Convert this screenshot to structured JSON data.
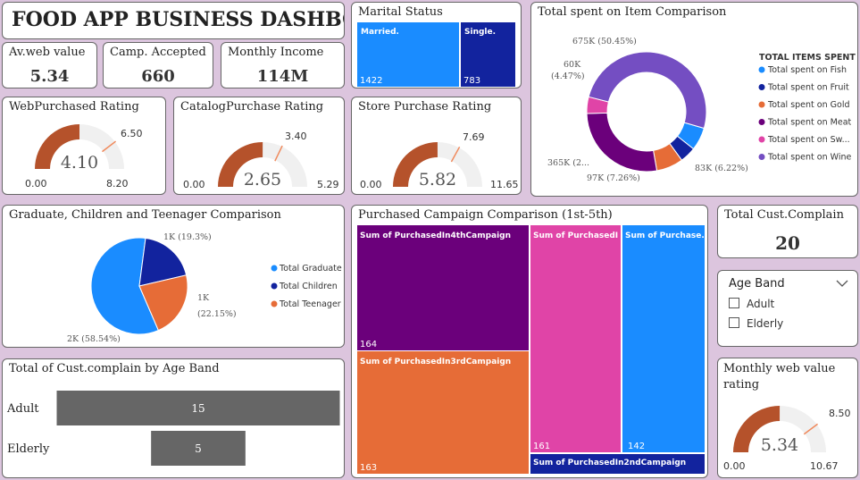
{
  "title": "FOOD APP BUSINESS DASHBOARD",
  "kpis": {
    "av_web": {
      "label": "Av.web value",
      "value": "5.34"
    },
    "camp": {
      "label": "Camp. Accepted",
      "value": "660"
    },
    "income": {
      "label": "Monthly Income",
      "value": "114M"
    },
    "complain": {
      "label": "Total Cust.Complain",
      "value": "20"
    }
  },
  "marital": {
    "title": "Marital Status",
    "chart_data": {
      "type": "treemap",
      "categories": [
        "Married.",
        "Single."
      ],
      "values": [
        1422,
        783
      ]
    },
    "labels": [
      "Married.",
      "Single."
    ],
    "values_text": [
      "1422",
      "783"
    ],
    "colors": [
      "#1a8cff",
      "#12239e"
    ]
  },
  "gauges": {
    "web": {
      "title": "WebPurchased Rating",
      "value": 4.1,
      "min": 0,
      "max": 8.2,
      "target": 6.5,
      "value_text": "4.10",
      "min_text": "0.00",
      "max_text": "8.20",
      "target_text": "6.50"
    },
    "catalog": {
      "title": "CatalogPurchase Rating",
      "value": 2.65,
      "min": 0,
      "max": 5.29,
      "target": 3.4,
      "value_text": "2.65",
      "min_text": "0.00",
      "max_text": "5.29",
      "target_text": "3.40"
    },
    "store": {
      "title": "Store Purchase Rating",
      "value": 5.82,
      "min": 0,
      "max": 11.65,
      "target": 7.69,
      "value_text": "5.82",
      "min_text": "0.00",
      "max_text": "11.65",
      "target_text": "7.69"
    },
    "monthly": {
      "title": "Monthly web value rating",
      "value": 5.34,
      "min": 0,
      "max": 10.67,
      "target": 8.5,
      "value_text": "5.34",
      "min_text": "0.00",
      "max_text": "10.67",
      "target_text": "8.50"
    }
  },
  "donut": {
    "title": "Total spent on Item Comparison",
    "legend_title": "TOTAL ITEMS SPENT",
    "chart_data": {
      "type": "donut",
      "categories": [
        "Total spent on Fish",
        "Total spent on Fruit",
        "Total spent on Gold",
        "Total spent on Meat",
        "Total spent on Sw...",
        "Total spent on Wine"
      ],
      "values": [
        83,
        58,
        97,
        365,
        60,
        675
      ],
      "unit": "K",
      "colors": [
        "#1a8cff",
        "#12239e",
        "#e66c37",
        "#6b007b",
        "#e044a7",
        "#744ec2"
      ]
    },
    "labels": {
      "wine": "675K (50.45%)",
      "sw_a": "60K",
      "sw_b": "(4.47%)",
      "meat": "365K (2...",
      "gold": "97K (7.26%)",
      "fish": "83K (6.22%)"
    }
  },
  "pie": {
    "title": "Graduate, Children and Teenager Comparison",
    "chart_data": {
      "type": "pie",
      "categories": [
        "Total Graduate",
        "Total Children",
        "Total Teenager"
      ],
      "values": [
        58.54,
        19.3,
        22.15
      ],
      "colors": [
        "#1a8cff",
        "#12239e",
        "#e66c37"
      ]
    },
    "labels": {
      "graduate": "2K (58.54%)",
      "children": "1K (19.3%)",
      "teen_a": "1K",
      "teen_b": "(22.15%)"
    }
  },
  "campaign": {
    "title": "Purchased Campaign Comparison (1st-5th)",
    "chart_data": {
      "type": "treemap",
      "categories": [
        "Sum of PurchasedIn4thCampaign",
        "Sum of PurchasedIn3rdCampaign",
        "Sum of PurchasedI...",
        "Sum of Purchase...",
        "Sum of PurchasedIn2ndCampaign"
      ],
      "values": [
        164,
        163,
        161,
        142,
        null
      ]
    },
    "tiles": [
      {
        "label": "Sum of PurchasedIn4thCampaign",
        "value": "164"
      },
      {
        "label": "Sum of PurchasedIn3rdCampaign",
        "value": "163"
      },
      {
        "label": "Sum of PurchasedI...",
        "value": "161"
      },
      {
        "label": "Sum of Purchase...",
        "value": "142"
      },
      {
        "label": "Sum of PurchasedIn2ndCampaign",
        "value": ""
      }
    ]
  },
  "bars": {
    "title": "Total of Cust.complain by Age Band",
    "chart_data": {
      "type": "bar",
      "categories": [
        "Adult",
        "Elderly"
      ],
      "values": [
        15,
        5
      ],
      "color": "#666666"
    },
    "values_text": [
      "15",
      "5"
    ]
  },
  "slicer": {
    "title": "Age Band",
    "items": [
      "Adult",
      "Elderly"
    ]
  }
}
